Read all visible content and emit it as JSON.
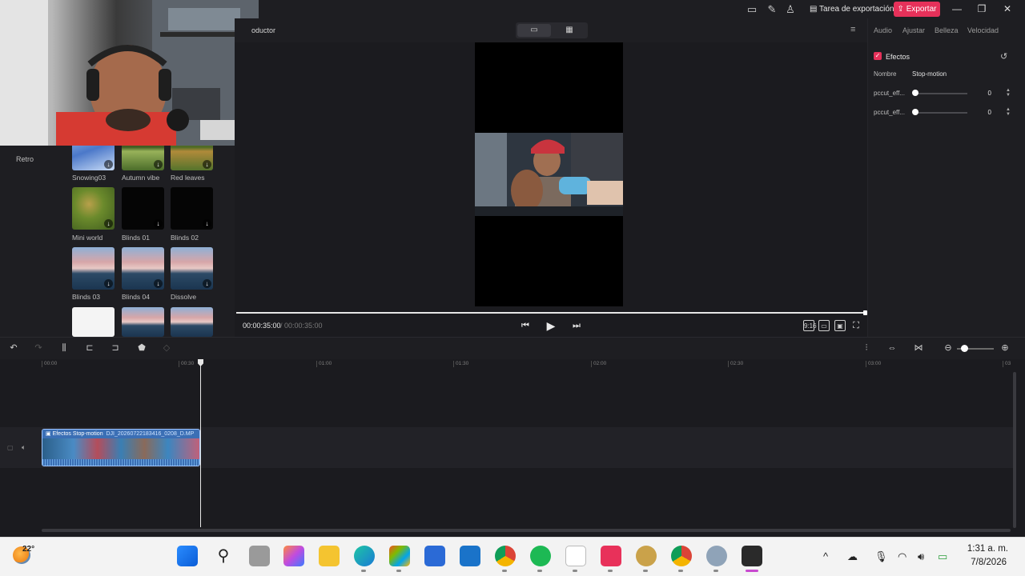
{
  "window": {
    "export_task_label": "Tarea de exportación",
    "export_label": "Exportar"
  },
  "left_panel": {
    "category": "Retro",
    "items": [
      {
        "label": "Snowing03",
        "icon": "download-icon"
      },
      {
        "label": "Autumn vibe",
        "icon": "download-icon"
      },
      {
        "label": "Red leaves",
        "icon": "download-icon"
      },
      {
        "label": "Mini world",
        "icon": "download-icon"
      },
      {
        "label": "Blinds 01",
        "icon": "download-icon"
      },
      {
        "label": "Blinds 02",
        "icon": "download-icon"
      },
      {
        "label": "Blinds 03",
        "icon": "download-icon"
      },
      {
        "label": "Blinds 04",
        "icon": "download-icon"
      },
      {
        "label": "Dissolve",
        "icon": "download-icon"
      }
    ]
  },
  "player": {
    "title": "oductor",
    "time_current": "00:00:35:00",
    "time_total": "/ 00:00:35:00",
    "progress": 1.0,
    "ratio_label": "9:16"
  },
  "right_panel": {
    "tabs": [
      "Audio",
      "Ajustar",
      "Belleza",
      "Velocidad"
    ],
    "section_title": "Efectos",
    "name_label": "Nombre",
    "name_value": "Stop-motion",
    "params": [
      {
        "label": "pccut_eff...",
        "value": "0"
      },
      {
        "label": "pccut_eff...",
        "value": "0"
      }
    ]
  },
  "timeline": {
    "ruler": [
      "00:00",
      "00:30",
      "01:00",
      "01:30",
      "02:00",
      "02:30",
      "03:00",
      "03"
    ],
    "clip": {
      "effect": "Efectos Stop-motion",
      "file": "DJI_20260722183416_0208_D.MP"
    }
  },
  "taskbar": {
    "temperature": "22°",
    "time": "1:31 a. m.",
    "date": "7/8/2026",
    "apps": [
      "windows-start-icon",
      "search-icon",
      "task-view-icon",
      "copilot-icon",
      "file-explorer-icon",
      "edge-icon",
      "store-icon",
      "word-icon",
      "outlook-icon",
      "chrome-icon",
      "spotify-icon",
      "notepad-icon",
      "tiktok-icon",
      "game-icon",
      "chrome-profile-icon",
      "settings-icon",
      "dji-icon"
    ]
  }
}
